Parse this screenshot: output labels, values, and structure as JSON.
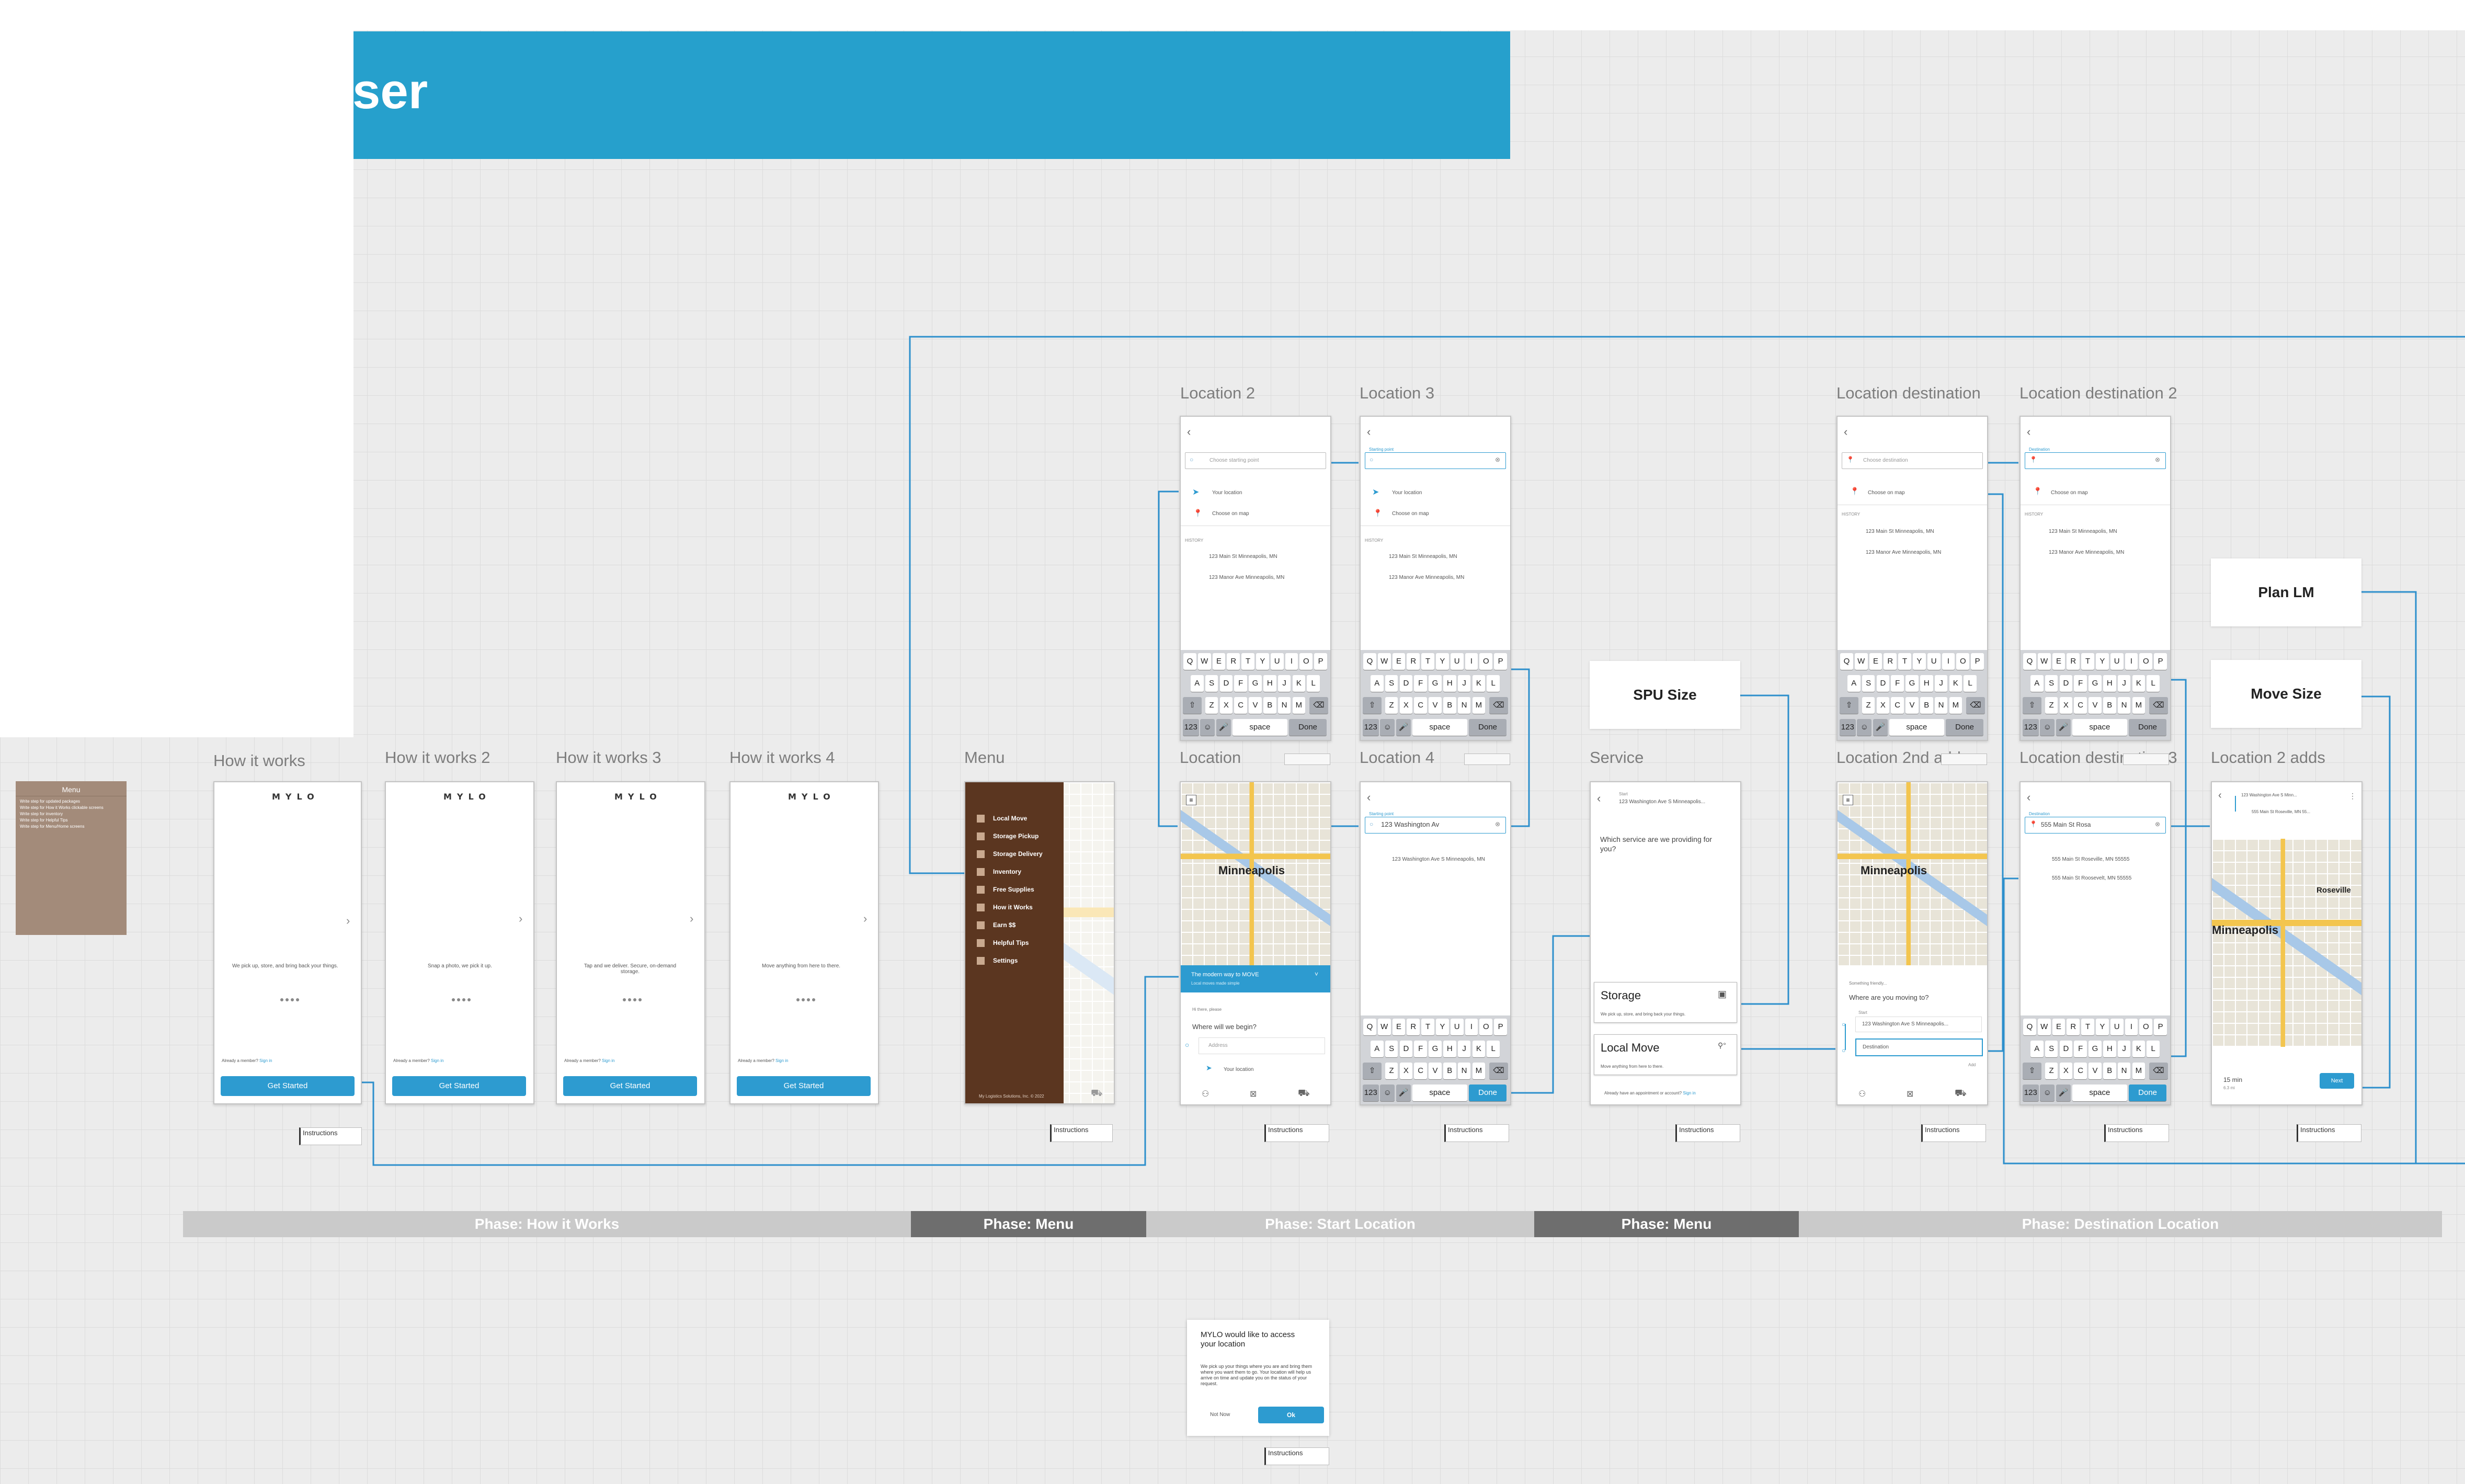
{
  "banner": {
    "title": "ser"
  },
  "sticky": {
    "title": "Menu",
    "bullets": [
      "Write step for updated packages",
      "Write step for How it Works clickable screens",
      "Write step for inventory",
      "Write step for Helpful Tips",
      "Write step for Menu/Home screens"
    ]
  },
  "screen_labels": {
    "how1": "How it works",
    "how2": "How it works 2",
    "how3": "How it works 3",
    "how4": "How it works 4",
    "menu": "Menu",
    "loc2": "Location 2",
    "loc3": "Location 3",
    "location": "Location",
    "loc4": "Location 4",
    "service": "Service",
    "dest": "Location destination",
    "dest2": "Location destination 2",
    "loc2nd": "Location 2nd add",
    "dest3": "Location destination 3",
    "loc2adds": "Location 2 adds"
  },
  "how_it_works": {
    "logo": "MYLO",
    "already": "Already a member?",
    "sign_in": "Sign in",
    "cta": "Get Started",
    "taglines": [
      "We pick up, store, and bring back your things.",
      "Snap a photo, we pick it up.",
      "Tap and we deliver. Secure, on-demand storage.",
      "Move anything from here to there."
    ]
  },
  "menu_screen": {
    "items": [
      "Local Move",
      "Storage Pickup",
      "Storage Delivery",
      "Inventory",
      "Free Supplies",
      "How it Works",
      "Earn $$",
      "Helpful Tips",
      "Settings"
    ],
    "footer": "My Logistics Solutions, Inc. © 2022"
  },
  "location_search": {
    "placeholder_start": "Choose starting point",
    "placeholder_dest": "Choose destination",
    "starting_point": "Starting point",
    "destination": "Destination",
    "your_location": "Your location",
    "choose_on_map": "Choose on map",
    "history": "HISTORY",
    "history_items": [
      "123 Main St Minneapolis, MN",
      "123 Manor Ave Minneapolis, MN"
    ],
    "typed_start": "123 Washington Av",
    "start_result": "123 Washington Ave S Minneapolis, MN",
    "typed_dest": "555 Main St Rosa",
    "dest_results": [
      "555 Main St Roseville, MN 55555",
      "555 Main St Roosevelt, MN 55555"
    ]
  },
  "keyboard": {
    "row1": [
      "Q",
      "W",
      "E",
      "R",
      "T",
      "Y",
      "U",
      "I",
      "O",
      "P"
    ],
    "row2": [
      "A",
      "S",
      "D",
      "F",
      "G",
      "H",
      "J",
      "K",
      "L"
    ],
    "row3": [
      "Z",
      "X",
      "C",
      "V",
      "B",
      "N",
      "M"
    ],
    "num": "123",
    "space": "space",
    "done": "Done"
  },
  "location_screen": {
    "map_label": "Minneapolis",
    "banner": "The modern way to MOVE",
    "banner_sub": "Local moves made simple",
    "greeting": "Hi there, please",
    "question": "Where will we begin?",
    "address_placeholder": "Address",
    "your_location": "Your location"
  },
  "service_screen": {
    "from_label": "Start",
    "from_address": "123 Washington Ave S Minneapolis...",
    "question": "Which service are we providing for you?",
    "options": [
      {
        "title": "Storage",
        "desc": "We pick up, store, and bring back your things."
      },
      {
        "title": "Local Move",
        "desc": "Move anything from here to there."
      }
    ],
    "footer": "Already have an appointment or account?",
    "footer_link": "Sign in"
  },
  "location_2nd": {
    "map_label": "Minneapolis",
    "small": "Something friendly...",
    "question": "Where are you moving to?",
    "start_label": "Start",
    "start_address": "123 Washington Ave S Minneapolis...",
    "dest_placeholder": "Destination",
    "add": "Add"
  },
  "location_2_adds": {
    "from": "123 Washington Ave S Minn...",
    "to": "555 Main St Roseville, MN 55...",
    "map_label": "Minneapolis",
    "map_label2": "Roseville",
    "time": "15 min",
    "distance": "6.3 mi",
    "next": "Next"
  },
  "notes": {
    "spu_size": "SPU Size",
    "plan_lm": "Plan LM",
    "move_size": "Move Size"
  },
  "instructions_label": "Instructions",
  "phases": [
    "Phase: How it Works",
    "Phase: Menu",
    "Phase: Start Location",
    "Phase: Menu",
    "Phase: Destination Location"
  ],
  "permission_dialog": {
    "title": "MYLO would like to access your location",
    "body": "We pick up your things where you are and bring them where you want them to go. Your location will help us arrive on time and update you on the status of your request.",
    "not_now": "Not Now",
    "ok": "Ok"
  },
  "colors": {
    "brand_blue": "#26a0cc",
    "button_blue": "#2d9bd0",
    "menu_brown": "#5b3620",
    "phase_light": "#cacaca",
    "phase_dark": "#6e6e6e"
  }
}
